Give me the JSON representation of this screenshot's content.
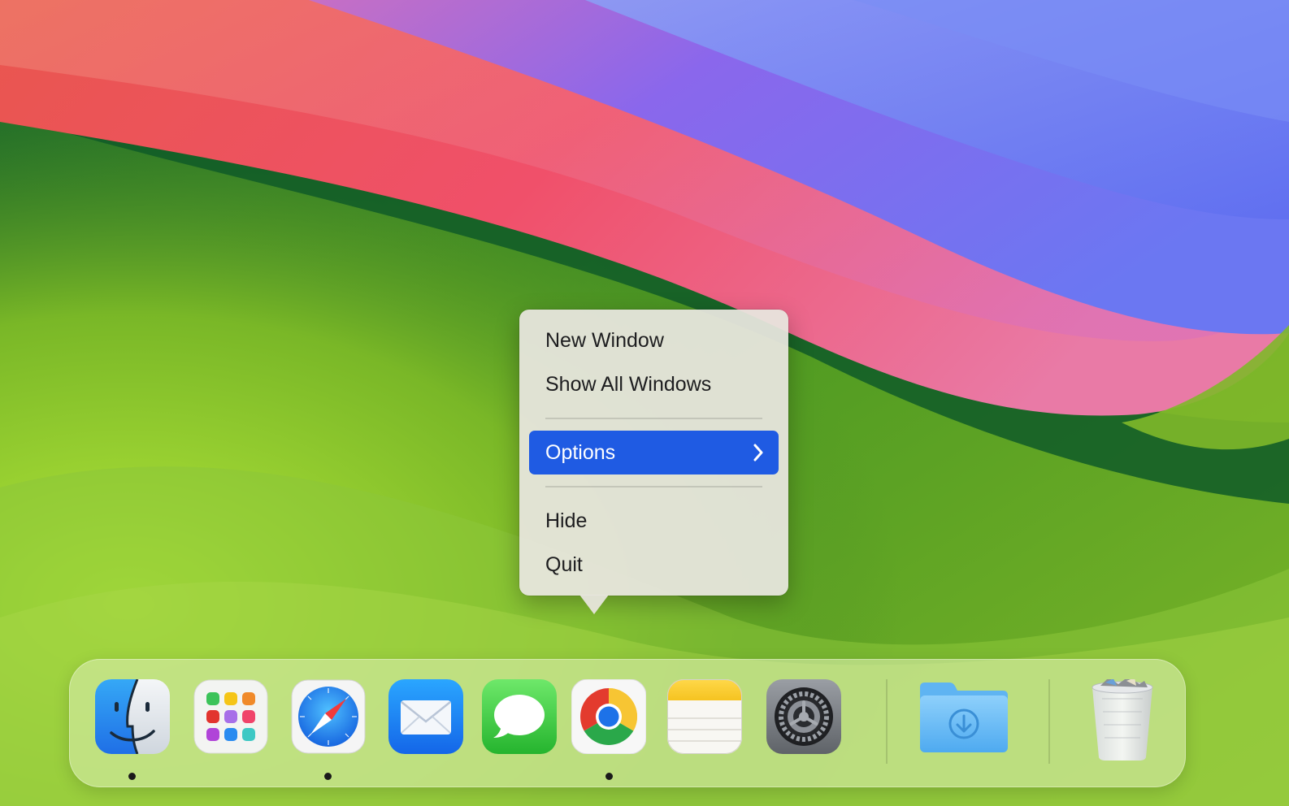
{
  "context_menu": {
    "items": [
      {
        "label": "New Window"
      },
      {
        "label": "Show All Windows"
      },
      {
        "label": "Options",
        "has_submenu": true,
        "highlighted": true
      },
      {
        "label": "Hide"
      },
      {
        "label": "Quit"
      }
    ],
    "highlight_color": "#1f5be3"
  },
  "dock": {
    "apps": [
      {
        "icon": "finder-icon",
        "running": true
      },
      {
        "icon": "launchpad-icon",
        "running": false
      },
      {
        "icon": "safari-icon",
        "running": true
      },
      {
        "icon": "mail-icon",
        "running": false
      },
      {
        "icon": "messages-icon",
        "running": false
      },
      {
        "icon": "chrome-icon",
        "running": true
      },
      {
        "icon": "notes-icon",
        "running": false
      },
      {
        "icon": "system-settings-icon",
        "running": false
      }
    ],
    "folders": [
      {
        "icon": "downloads-folder-icon"
      }
    ],
    "trash": {
      "icon": "trash-icon"
    }
  }
}
